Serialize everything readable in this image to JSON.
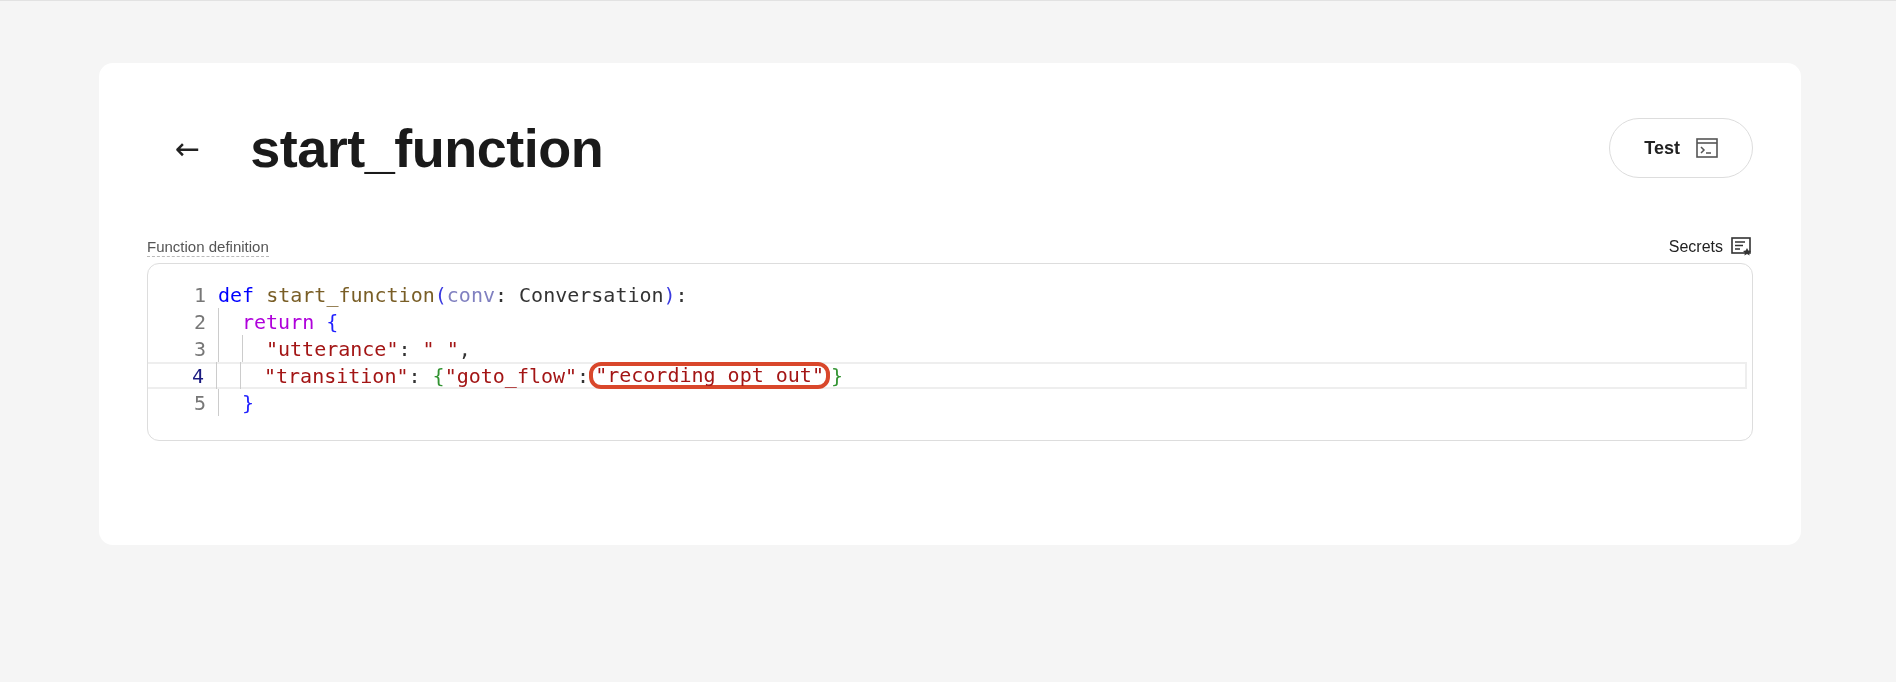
{
  "page": {
    "title": "start_function",
    "back_button": "←"
  },
  "test_button": {
    "label": "Test"
  },
  "function_definition": {
    "label": "Function definition",
    "secrets_button": {
      "label": "Secrets"
    },
    "code": [
      {
        "number": "1",
        "active": false,
        "tokens": [
          {
            "kind": "keyword",
            "text": "def "
          },
          {
            "kind": "function",
            "text": "start_function"
          },
          {
            "kind": "paren",
            "text": "("
          },
          {
            "kind": "param",
            "text": "conv"
          },
          {
            "kind": "plain",
            "text": ": Conversation"
          },
          {
            "kind": "paren",
            "text": ")"
          },
          {
            "kind": "plain",
            "text": ":"
          }
        ],
        "children": [
          {
            "number": "2",
            "active": false,
            "tokens": [
              {
                "kind": "control",
                "text": "return "
              },
              {
                "kind": "brace",
                "text": "{"
              }
            ],
            "children": [
              {
                "number": "3",
                "active": false,
                "tokens": [
                  {
                    "kind": "string",
                    "text": "\"utterance\""
                  },
                  {
                    "kind": "plain",
                    "text": ": "
                  },
                  {
                    "kind": "string",
                    "text": "\" \""
                  },
                  {
                    "kind": "plain",
                    "text": ","
                  }
                ]
              },
              {
                "number": "4",
                "active": true,
                "tokens": [
                  {
                    "kind": "string",
                    "text": "\"transition\""
                  },
                  {
                    "kind": "plain",
                    "text": ": "
                  },
                  {
                    "kind": "brace2",
                    "text": "{"
                  },
                  {
                    "kind": "string",
                    "text": "\"goto_flow\""
                  },
                  {
                    "kind": "plain",
                    "text": ":"
                  },
                  {
                    "kind": "string",
                    "text": "\"recording opt out\"",
                    "circled": true
                  },
                  {
                    "kind": "brace2",
                    "text": "}"
                  }
                ]
              }
            ]
          },
          {
            "number": "5",
            "active": false,
            "tokens": [
              {
                "kind": "brace",
                "text": "}"
              }
            ]
          }
        ]
      }
    ]
  }
}
